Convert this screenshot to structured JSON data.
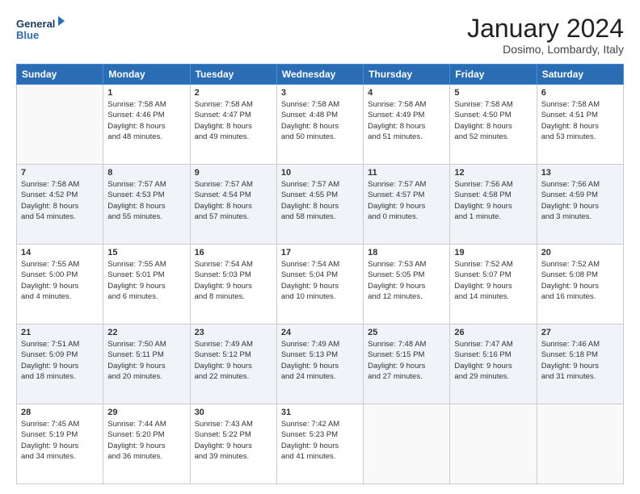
{
  "header": {
    "logo_line1": "General",
    "logo_line2": "Blue",
    "month_title": "January 2024",
    "location": "Dosimo, Lombardy, Italy"
  },
  "days_of_week": [
    "Sunday",
    "Monday",
    "Tuesday",
    "Wednesday",
    "Thursday",
    "Friday",
    "Saturday"
  ],
  "weeks": [
    [
      {
        "day": "",
        "text": ""
      },
      {
        "day": "1",
        "text": "Sunrise: 7:58 AM\nSunset: 4:46 PM\nDaylight: 8 hours\nand 48 minutes."
      },
      {
        "day": "2",
        "text": "Sunrise: 7:58 AM\nSunset: 4:47 PM\nDaylight: 8 hours\nand 49 minutes."
      },
      {
        "day": "3",
        "text": "Sunrise: 7:58 AM\nSunset: 4:48 PM\nDaylight: 8 hours\nand 50 minutes."
      },
      {
        "day": "4",
        "text": "Sunrise: 7:58 AM\nSunset: 4:49 PM\nDaylight: 8 hours\nand 51 minutes."
      },
      {
        "day": "5",
        "text": "Sunrise: 7:58 AM\nSunset: 4:50 PM\nDaylight: 8 hours\nand 52 minutes."
      },
      {
        "day": "6",
        "text": "Sunrise: 7:58 AM\nSunset: 4:51 PM\nDaylight: 8 hours\nand 53 minutes."
      }
    ],
    [
      {
        "day": "7",
        "text": "Sunrise: 7:58 AM\nSunset: 4:52 PM\nDaylight: 8 hours\nand 54 minutes."
      },
      {
        "day": "8",
        "text": "Sunrise: 7:57 AM\nSunset: 4:53 PM\nDaylight: 8 hours\nand 55 minutes."
      },
      {
        "day": "9",
        "text": "Sunrise: 7:57 AM\nSunset: 4:54 PM\nDaylight: 8 hours\nand 57 minutes."
      },
      {
        "day": "10",
        "text": "Sunrise: 7:57 AM\nSunset: 4:55 PM\nDaylight: 8 hours\nand 58 minutes."
      },
      {
        "day": "11",
        "text": "Sunrise: 7:57 AM\nSunset: 4:57 PM\nDaylight: 9 hours\nand 0 minutes."
      },
      {
        "day": "12",
        "text": "Sunrise: 7:56 AM\nSunset: 4:58 PM\nDaylight: 9 hours\nand 1 minute."
      },
      {
        "day": "13",
        "text": "Sunrise: 7:56 AM\nSunset: 4:59 PM\nDaylight: 9 hours\nand 3 minutes."
      }
    ],
    [
      {
        "day": "14",
        "text": "Sunrise: 7:55 AM\nSunset: 5:00 PM\nDaylight: 9 hours\nand 4 minutes."
      },
      {
        "day": "15",
        "text": "Sunrise: 7:55 AM\nSunset: 5:01 PM\nDaylight: 9 hours\nand 6 minutes."
      },
      {
        "day": "16",
        "text": "Sunrise: 7:54 AM\nSunset: 5:03 PM\nDaylight: 9 hours\nand 8 minutes."
      },
      {
        "day": "17",
        "text": "Sunrise: 7:54 AM\nSunset: 5:04 PM\nDaylight: 9 hours\nand 10 minutes."
      },
      {
        "day": "18",
        "text": "Sunrise: 7:53 AM\nSunset: 5:05 PM\nDaylight: 9 hours\nand 12 minutes."
      },
      {
        "day": "19",
        "text": "Sunrise: 7:52 AM\nSunset: 5:07 PM\nDaylight: 9 hours\nand 14 minutes."
      },
      {
        "day": "20",
        "text": "Sunrise: 7:52 AM\nSunset: 5:08 PM\nDaylight: 9 hours\nand 16 minutes."
      }
    ],
    [
      {
        "day": "21",
        "text": "Sunrise: 7:51 AM\nSunset: 5:09 PM\nDaylight: 9 hours\nand 18 minutes."
      },
      {
        "day": "22",
        "text": "Sunrise: 7:50 AM\nSunset: 5:11 PM\nDaylight: 9 hours\nand 20 minutes."
      },
      {
        "day": "23",
        "text": "Sunrise: 7:49 AM\nSunset: 5:12 PM\nDaylight: 9 hours\nand 22 minutes."
      },
      {
        "day": "24",
        "text": "Sunrise: 7:49 AM\nSunset: 5:13 PM\nDaylight: 9 hours\nand 24 minutes."
      },
      {
        "day": "25",
        "text": "Sunrise: 7:48 AM\nSunset: 5:15 PM\nDaylight: 9 hours\nand 27 minutes."
      },
      {
        "day": "26",
        "text": "Sunrise: 7:47 AM\nSunset: 5:16 PM\nDaylight: 9 hours\nand 29 minutes."
      },
      {
        "day": "27",
        "text": "Sunrise: 7:46 AM\nSunset: 5:18 PM\nDaylight: 9 hours\nand 31 minutes."
      }
    ],
    [
      {
        "day": "28",
        "text": "Sunrise: 7:45 AM\nSunset: 5:19 PM\nDaylight: 9 hours\nand 34 minutes."
      },
      {
        "day": "29",
        "text": "Sunrise: 7:44 AM\nSunset: 5:20 PM\nDaylight: 9 hours\nand 36 minutes."
      },
      {
        "day": "30",
        "text": "Sunrise: 7:43 AM\nSunset: 5:22 PM\nDaylight: 9 hours\nand 39 minutes."
      },
      {
        "day": "31",
        "text": "Sunrise: 7:42 AM\nSunset: 5:23 PM\nDaylight: 9 hours\nand 41 minutes."
      },
      {
        "day": "",
        "text": ""
      },
      {
        "day": "",
        "text": ""
      },
      {
        "day": "",
        "text": ""
      }
    ]
  ]
}
